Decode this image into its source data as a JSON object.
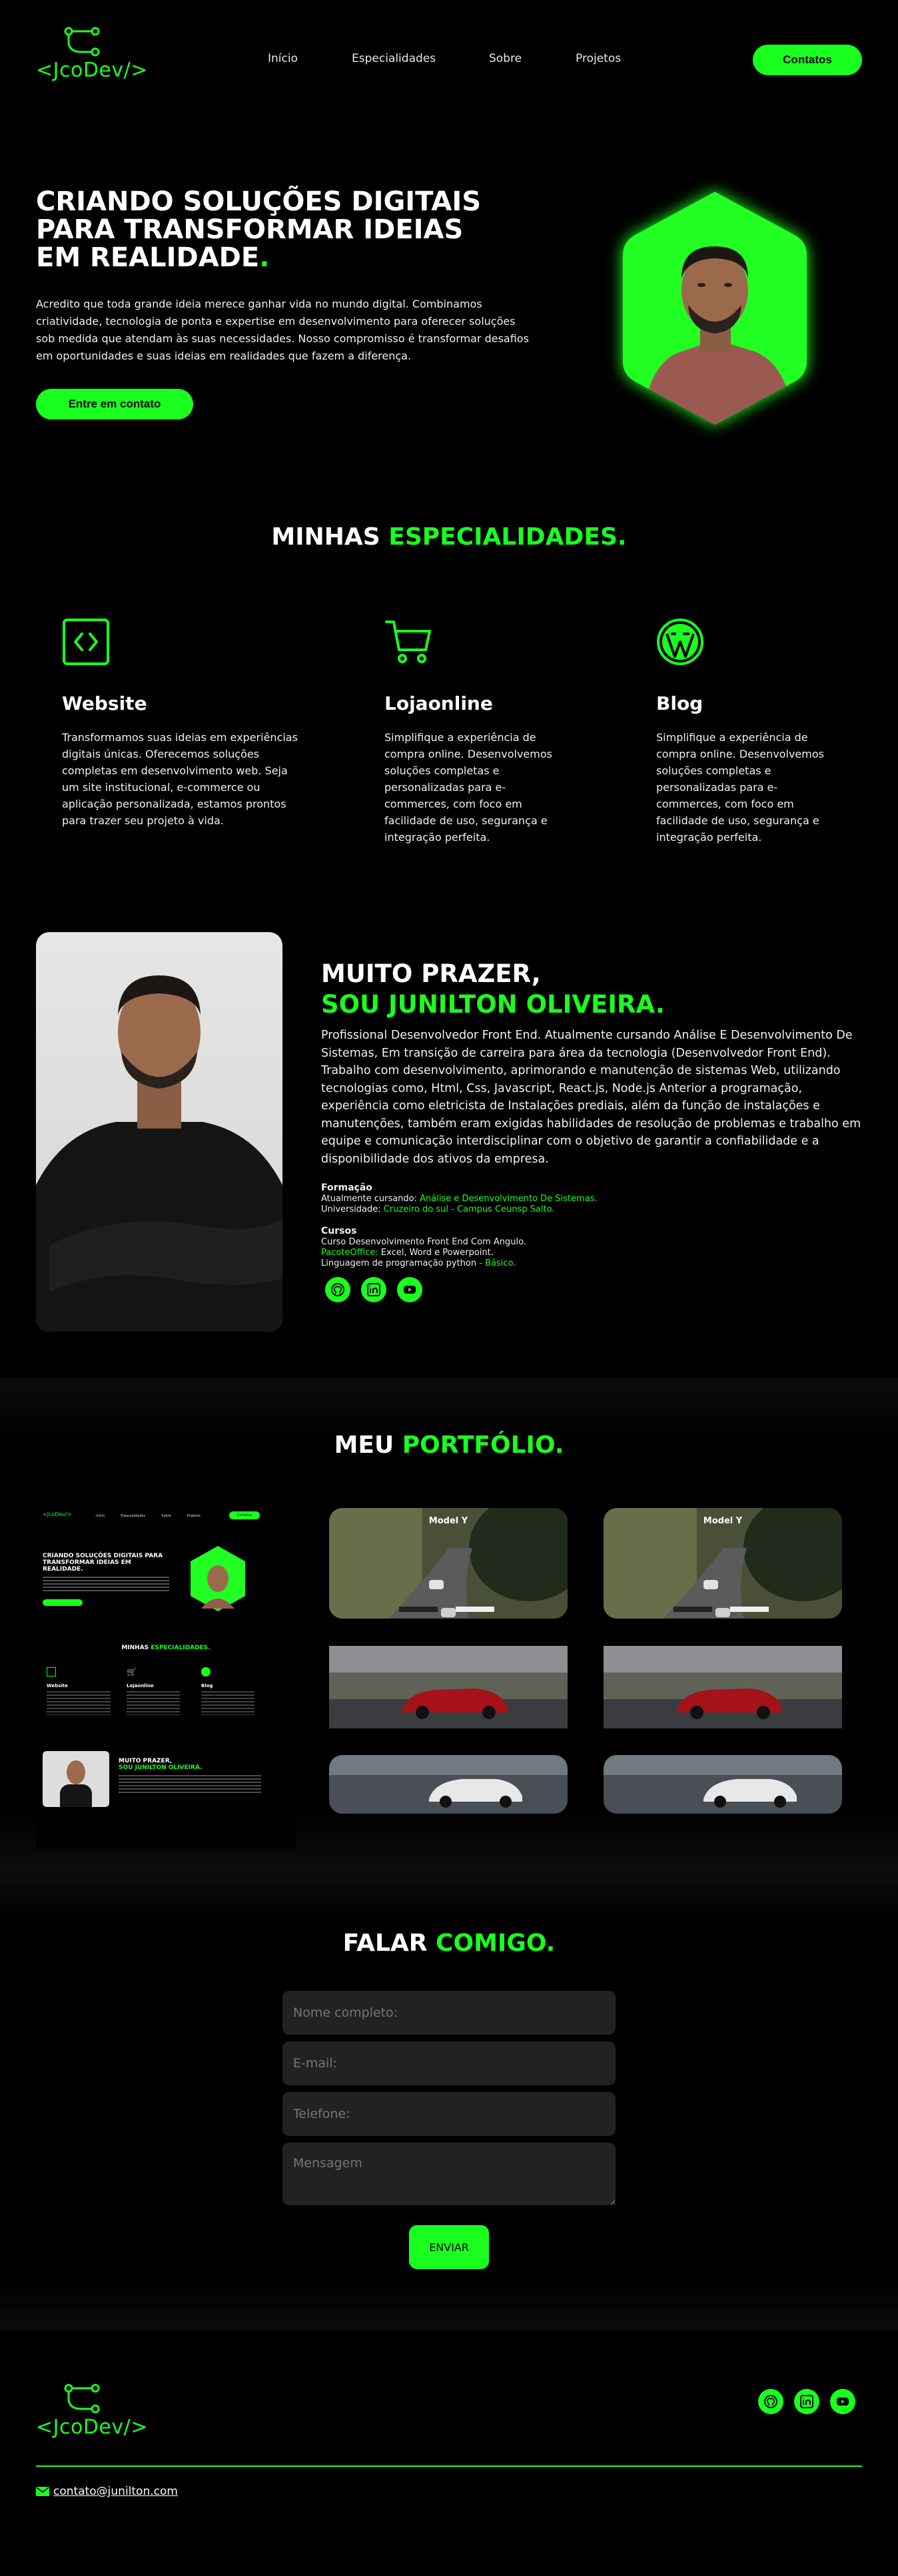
{
  "header": {
    "logo_text": "<JcoDev/>",
    "nav": [
      "Início",
      "Especialidades",
      "Sobre",
      "Projetos"
    ],
    "cta": "Contatos"
  },
  "hero": {
    "title": "Criando soluções digitais para transformar ideias em realidade",
    "title_dot": ".",
    "description": "Acredito que toda grande ideia merece ganhar vida no mundo digital. Combinamos criatividade, tecnologia de ponta e expertise em desenvolvimento para oferecer soluções sob medida que atendam às suas necessidades. Nosso compromisso é transformar desafios em oportunidades e suas ideias em realidades que fazem a diferença.",
    "button": "Entre em contato"
  },
  "specialties": {
    "title_white": "Minhas",
    "title_green": "especialidades.",
    "cards": [
      {
        "icon": "code-icon",
        "title": "Website",
        "text": "Transformamos suas ideias em experiências digitais únicas. Oferecemos soluções completas em desenvolvimento web. Seja um site institucional, e-commerce ou aplicação personalizada, estamos prontos para trazer seu projeto à vida."
      },
      {
        "icon": "cart-icon",
        "title": "Lojaonline",
        "text": "Simplifique a experiência de compra online. Desenvolvemos soluções completas e personalizadas para e-commerces, com foco em facilidade de uso, segurança e integração perfeita."
      },
      {
        "icon": "wordpress-icon",
        "title": "Blog",
        "text": "Simplifique a experiência de compra online. Desenvolvemos soluções completas e personalizadas para e-commerces, com foco em facilidade de uso, segurança e integração perfeita."
      }
    ]
  },
  "about": {
    "title_white": "Muito prazer,",
    "title_green": "Sou Junilton Oliveira.",
    "bio": "Profissional Desenvolvedor Front End. Atualmente cursando Análise E Desenvolvimento De Sistemas, Em transição de carreira para área da tecnologia (Desenvolvedor Front End). Trabalho com desenvolvimento, aprimorando e manutenção de sistemas Web, utilizando tecnologias como, Html, Css, Javascript, React.js, Node.js Anterior a programação, experiência como eletricista de Instalações prediais, além da função de instalações e manutenções, também eram exigidas habilidades de resolução de problemas e trabalho em equipe e comunicação interdisciplinar com o objetivo de garantir a confiabilidade e a disponibilidade dos ativos da empresa.",
    "formation_label": "Formação",
    "formation_line1_prefix": "Atualmente cursando: ",
    "formation_line1_value": "Análise e Desenvolvimento De Sistemas.",
    "formation_line2_prefix": "Universidade: ",
    "formation_line2_value": "Cruzeiro do sul - Campus Ceunsp Salto.",
    "courses_label": "Cursos",
    "course1": "Curso Desenvolvimento Front End Com Angulo.",
    "course2_prefix": "PacoteOffice: ",
    "course2_value": "Excel, Word e Powerpoint.",
    "course3_prefix": "Linguagem de programação python ",
    "course3_value": "- Básico."
  },
  "portfolio": {
    "title_white": "Meu",
    "title_green": "Portfólio.",
    "mini": {
      "logo": "<JcoDev/>",
      "nav": [
        "Início",
        "Especialidades",
        "Sobre",
        "Projetos"
      ],
      "cta": "Contatos",
      "hero_title": "Criando soluções digitais para transformar ideias em realidade.",
      "spec_white": "Minhas",
      "spec_green": "especialidades.",
      "cards": [
        "Website",
        "Lojaonline",
        "Blog"
      ],
      "about_white": "Muito prazer,",
      "about_green": "Sou Junilton Oliveira."
    },
    "thumbs": [
      {
        "title": "Model Y"
      },
      {
        "title": "Model Y"
      }
    ]
  },
  "contact": {
    "title_white": "Falar",
    "title_green": "comigo.",
    "name_placeholder": "Nome completo:",
    "email_placeholder": "E-mail:",
    "phone_placeholder": "Telefone:",
    "message_placeholder": "Mensagem",
    "send": "ENVIAR"
  },
  "footer": {
    "logo_text": "<JcoDev/>",
    "email": "contato@junilton.com"
  },
  "colors": {
    "accent": "#19ff1e",
    "background": "#000000"
  }
}
